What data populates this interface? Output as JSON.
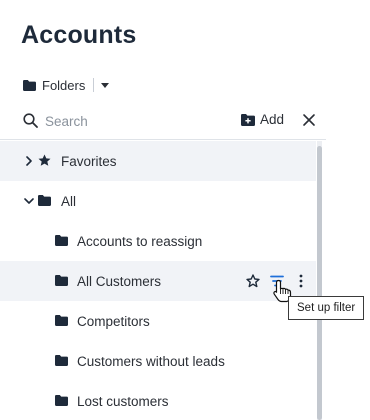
{
  "page": {
    "title": "Accounts"
  },
  "folders_selector": {
    "label": "Folders"
  },
  "search": {
    "placeholder": "Search",
    "value": ""
  },
  "toolbar": {
    "add_label": "Add"
  },
  "tree": {
    "favorites": {
      "label": "Favorites",
      "expanded": false
    },
    "all": {
      "label": "All",
      "expanded": true
    },
    "items": [
      {
        "label": "Accounts to reassign"
      },
      {
        "label": "All Customers",
        "hovered": true
      },
      {
        "label": "Competitors"
      },
      {
        "label": "Customers without leads"
      },
      {
        "label": "Lost customers"
      }
    ]
  },
  "tooltip": {
    "text": "Set up filter"
  },
  "icons": {
    "folder": "folder-icon",
    "search": "search-icon",
    "add": "folder-add-icon",
    "close": "close-icon",
    "favorite": "star-icon",
    "filter": "filter-icon",
    "more": "more-vertical-icon",
    "cursor": "hand-pointer-icon"
  },
  "colors": {
    "accent": "#1e6fd9",
    "text": "#2b2f36",
    "selected_bg": "#f1f3f7"
  }
}
